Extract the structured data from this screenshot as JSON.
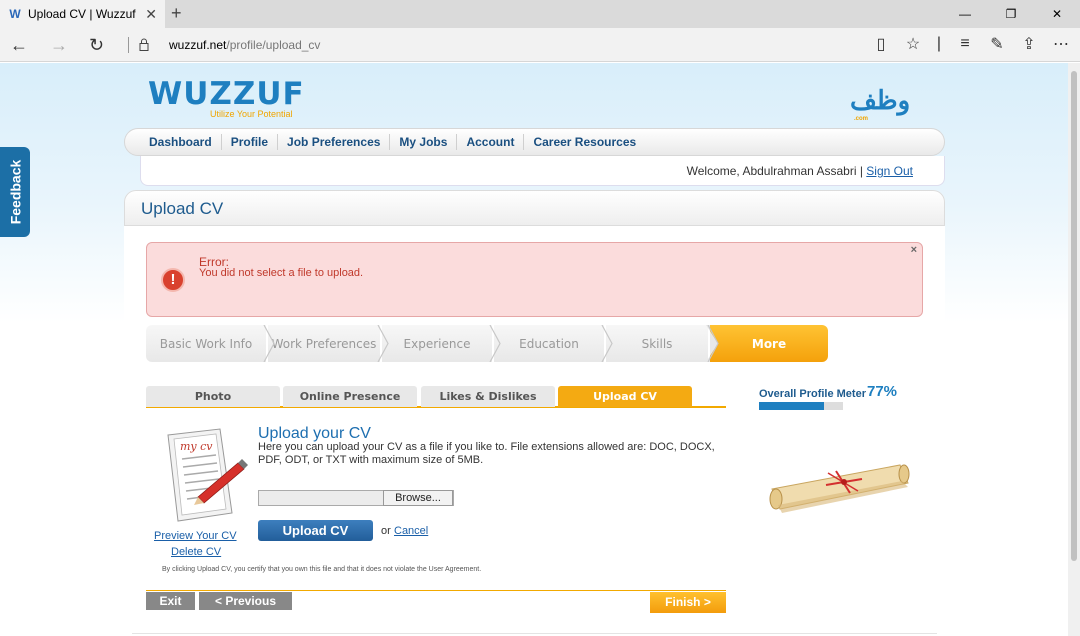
{
  "browser": {
    "tab_title": "Upload CV | Wuzzuf",
    "favicon": "W",
    "url_host": "wuzzuf.net",
    "url_path": "/profile/upload_cv"
  },
  "site": {
    "logo_text": "WUZZUF",
    "logo_tagline": "Utilize Your Potential",
    "arabic_logo": "وظف",
    "arabic_logo_sub": ".com",
    "feedback_label": "Feedback"
  },
  "nav": {
    "items": [
      "Dashboard",
      "Profile",
      "Job Preferences",
      "My Jobs",
      "Account",
      "Career Resources"
    ]
  },
  "welcome": {
    "text": "Welcome, Abdulrahman Assabri | ",
    "signout": "Sign Out"
  },
  "page": {
    "title": "Upload CV"
  },
  "error": {
    "title": "Error:",
    "message": "You did not select a file to upload.",
    "close": "×"
  },
  "steps": {
    "items": [
      "Basic Work Info",
      "Work Preferences",
      "Experience",
      "Education",
      "Skills",
      "More"
    ]
  },
  "subtabs": {
    "items": [
      "Photo",
      "Online Presence",
      "Likes & Dislikes",
      "Upload CV"
    ]
  },
  "meter": {
    "label": "Overall Profile Meter",
    "percent_text": "77%",
    "value": 0.77
  },
  "upload": {
    "heading": "Upload your CV",
    "description": "Here you can upload your CV as a file if you like to. File extensions allowed are: DOC, DOCX, PDF, ODT, or TXT with maximum size of 5MB.",
    "browse": "Browse...",
    "upload_button": "Upload CV",
    "or": "or",
    "cancel": "Cancel",
    "preview": "Preview Your CV",
    "delete": "Delete CV",
    "agreement": "By clicking Upload CV, you certify that you own this file and that it does not violate the User Agreement.",
    "doc_label": "my cv"
  },
  "footer": {
    "exit": "Exit",
    "previous": "< Previous",
    "finish": "Finish >"
  }
}
